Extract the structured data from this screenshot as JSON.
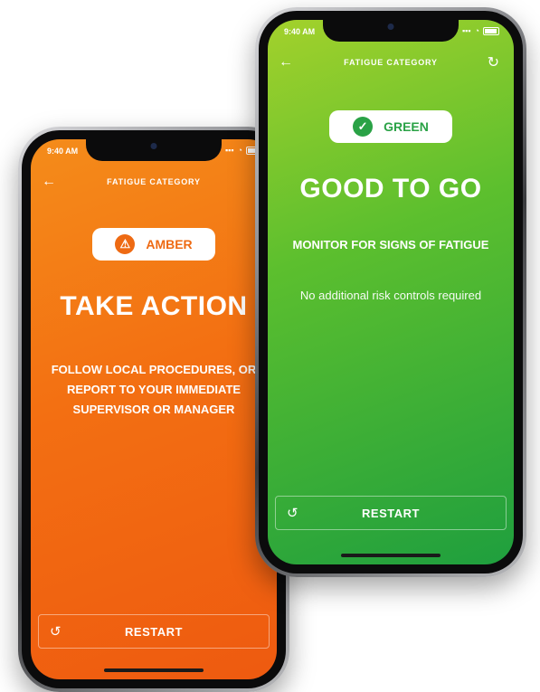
{
  "screens": {
    "amber": {
      "time": "9:40 AM",
      "nav_title": "FATIGUE CATEGORY",
      "badge_label": "AMBER",
      "headline": "TAKE ACTION",
      "subhead": "FOLLOW LOCAL PROCEDURES, OR REPORT TO YOUR IMMEDIATE SUPERVISOR OR MANAGER",
      "restart_label": "RESTART",
      "icons": {
        "back": "back-arrow-icon",
        "badge": "warning-icon",
        "restart": "restart-icon"
      },
      "accent": "#ee6a13"
    },
    "green": {
      "time": "9:40 AM",
      "nav_title": "FATIGUE CATEGORY",
      "badge_label": "GREEN",
      "headline": "GOOD TO GO",
      "subhead": "MONITOR FOR SIGNS OF FATIGUE",
      "detail": "No additional risk controls required",
      "restart_label": "RESTART",
      "icons": {
        "back": "back-arrow-icon",
        "badge": "checkmark-icon",
        "refresh": "refresh-icon",
        "restart": "restart-icon"
      },
      "accent": "#2aa246"
    }
  }
}
